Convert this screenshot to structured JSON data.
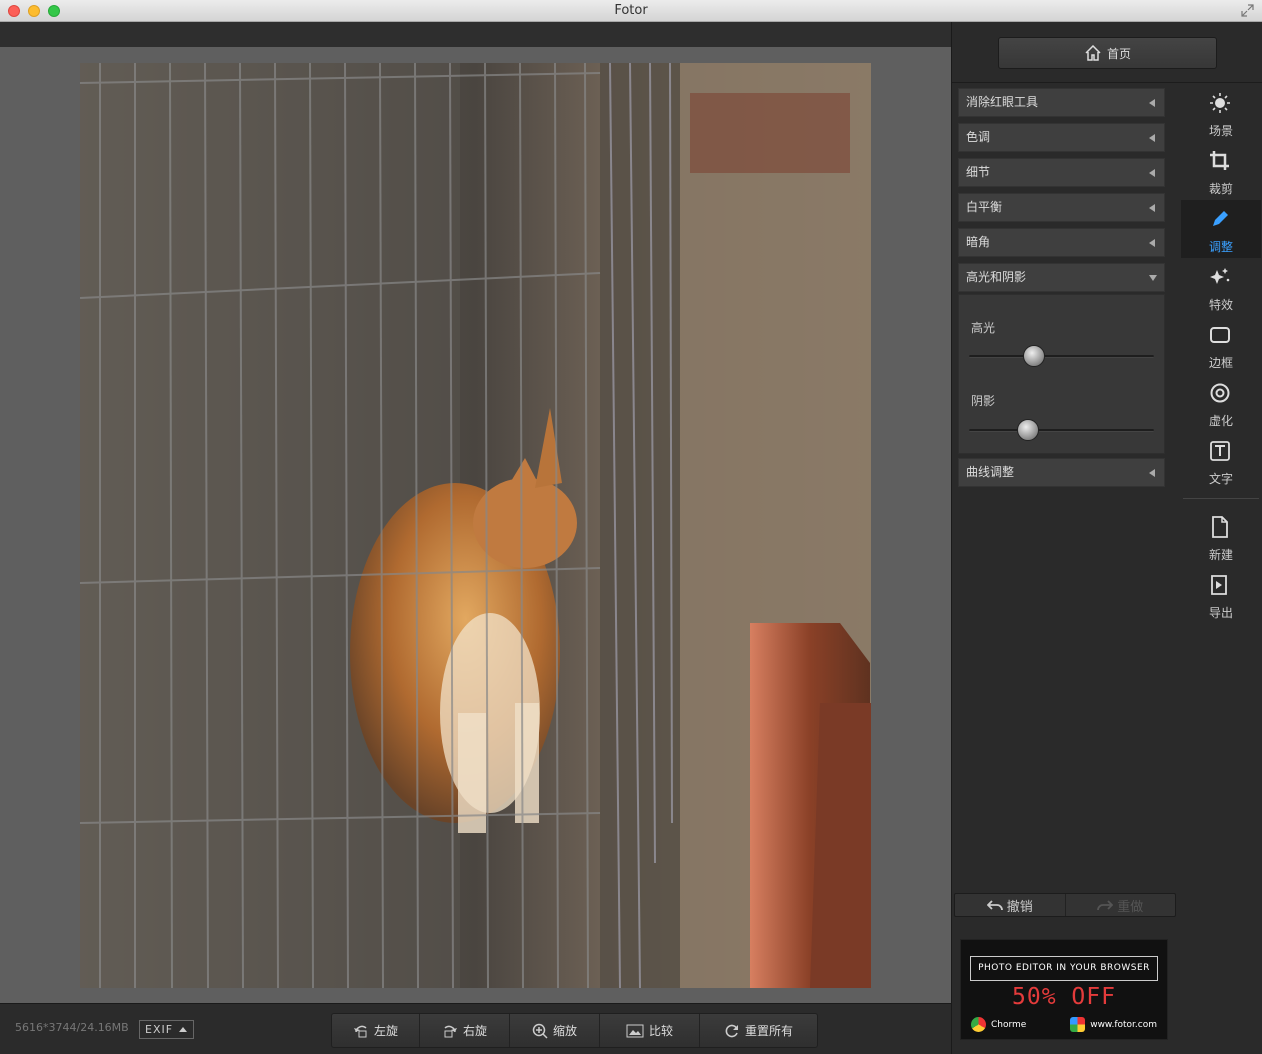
{
  "window": {
    "title": "Fotor"
  },
  "image_info": {
    "dimensions_size": "5616*3744/24.16MB",
    "exif_label": "EXIF"
  },
  "bottom_tools": [
    {
      "label": "左旋",
      "icon": "rotate-left-icon"
    },
    {
      "label": "右旋",
      "icon": "rotate-right-icon"
    },
    {
      "label": "缩放",
      "icon": "zoom-icon"
    },
    {
      "label": "比较",
      "icon": "compare-icon"
    },
    {
      "label": "重置所有",
      "icon": "reset-icon"
    }
  ],
  "home": {
    "label": "首页"
  },
  "adjust_panel": {
    "items": [
      {
        "label": "消除红眼工具"
      },
      {
        "label": "色调"
      },
      {
        "label": "细节"
      },
      {
        "label": "白平衡"
      },
      {
        "label": "暗角"
      },
      {
        "label": "高光和阴影",
        "expanded": true
      },
      {
        "label": "曲线调整"
      }
    ],
    "highlights": {
      "label": "高光",
      "value": 0.35
    },
    "shadows": {
      "label": "阴影",
      "value": 0.32
    }
  },
  "sidebar": {
    "items": [
      {
        "label": "场景",
        "icon": "sun-icon"
      },
      {
        "label": "裁剪",
        "icon": "crop-icon"
      },
      {
        "label": "调整",
        "icon": "pencil-icon",
        "active": true
      },
      {
        "label": "特效",
        "icon": "sparkle-icon"
      },
      {
        "label": "边框",
        "icon": "frame-icon"
      },
      {
        "label": "虚化",
        "icon": "blur-icon"
      },
      {
        "label": "文字",
        "icon": "text-icon"
      },
      {
        "label": "新建",
        "icon": "new-file-icon"
      },
      {
        "label": "导出",
        "icon": "export-icon"
      }
    ]
  },
  "history": {
    "undo": "撤销",
    "redo": "重做"
  },
  "ad": {
    "headline": "PHOTO EDITOR IN YOUR BROWSER",
    "offer": "50% OFF",
    "browser": "Chorme",
    "url": "www.fotor.com",
    "offer_color": "#e43b3b"
  },
  "colors": {
    "accent": "#3aa0ff",
    "panel_bg": "#2a2a2a",
    "canvas_bg": "#5f5f5f"
  }
}
